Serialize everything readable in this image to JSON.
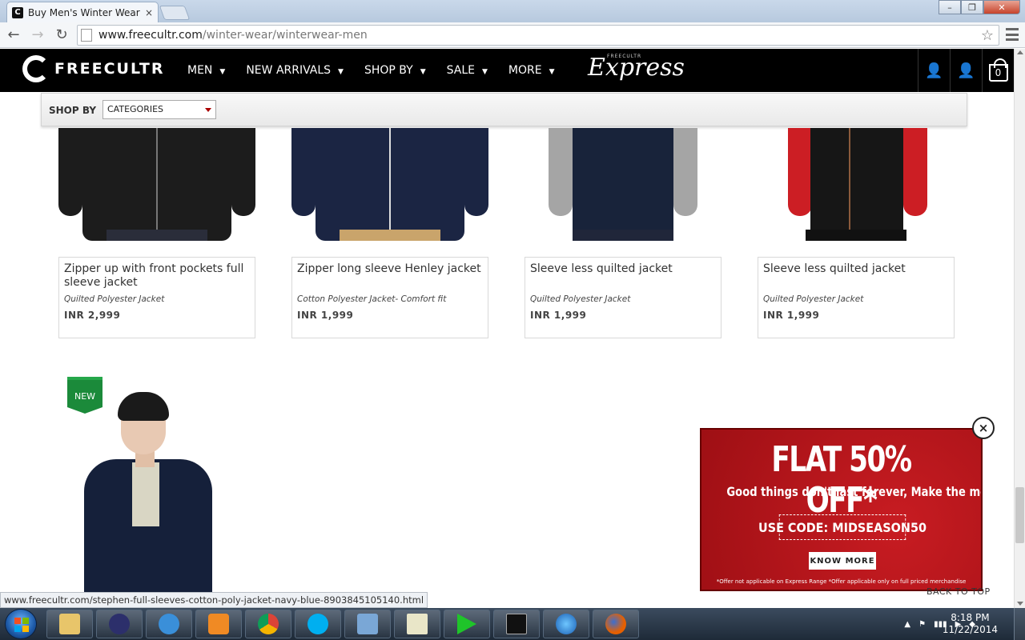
{
  "browser": {
    "tab_title": "Buy Men's Winter Wear Ra",
    "tab_close": "×",
    "url_host": "www.freecultr.com",
    "url_path": "/winter-wear/winterwear-men",
    "status_url": "www.freecultr.com/stephen-full-sleeves-cotton-poly-jacket-navy-blue-8903845105140.html"
  },
  "site": {
    "logo": "FREECULTR",
    "nav": [
      {
        "label": "MEN"
      },
      {
        "label": "NEW ARRIVALS"
      },
      {
        "label": "SHOP BY"
      },
      {
        "label": "SALE"
      },
      {
        "label": "MORE"
      }
    ],
    "express_small": "FREECULTR",
    "express_big": "Express",
    "cart_count": "0"
  },
  "shopby": {
    "label": "SHOP BY",
    "select_value": "CATEGORIES"
  },
  "products": [
    {
      "name": "Zipper up with front pockets full sleeve jacket",
      "sub": "Quilted Polyester Jacket",
      "price": "INR  2,999",
      "color": "#1c1c1c",
      "sleeve": "#1c1c1c"
    },
    {
      "name": "Zipper long sleeve Henley jacket",
      "sub": "Cotton Polyester Jacket- Comfort fit",
      "price": "INR  1,999",
      "color": "#1b2543",
      "sleeve": "#1b2543"
    },
    {
      "name": "Sleeve less quilted jacket",
      "sub": "Quilted Polyester Jacket",
      "price": "INR  1,999",
      "color": "#18233a",
      "sleeve": "#a5a5a5"
    },
    {
      "name": "Sleeve less quilted jacket",
      "sub": "Quilted Polyester Jacket",
      "price": "INR  1,999",
      "color": "#161616",
      "sleeve": "#cc1e24"
    }
  ],
  "new_badge": "NEW",
  "promo": {
    "headline": "FLAT 50% OFF*",
    "tagline": "Good things don't last forever, Make the most of it now!",
    "code": "USE CODE: MIDSEASON50",
    "button": "KNOW MORE",
    "fine_print": "*Offer not applicable on Express Range  *Offer applicable only on full priced merchandise",
    "close": "×"
  },
  "back_to_top": "BACK TO TOP",
  "taskbar": {
    "time": "8:18 PM",
    "date": "11/22/2014"
  }
}
